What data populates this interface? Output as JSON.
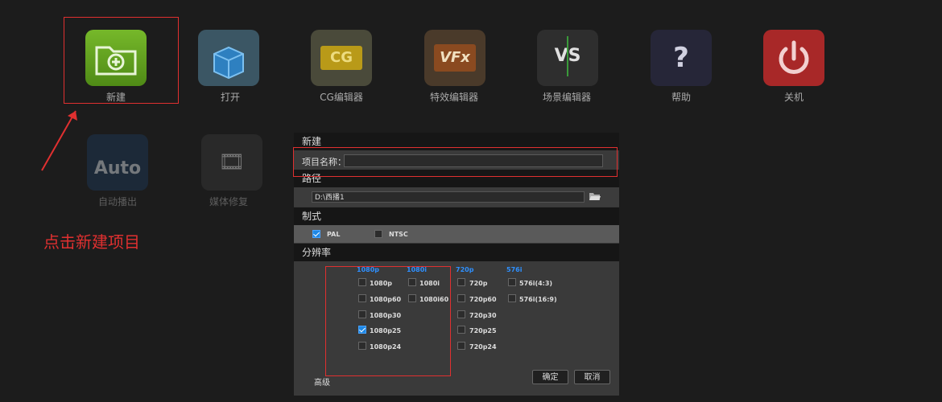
{
  "apps": [
    {
      "label": "新建",
      "glyph": "⊕"
    },
    {
      "label": "打开",
      "glyph": "📦"
    },
    {
      "label": "CG编辑器",
      "glyph": "CG"
    },
    {
      "label": "特效编辑器",
      "glyph": "VFx"
    },
    {
      "label": "场景编辑器",
      "glyph": "VS"
    },
    {
      "label": "帮助",
      "glyph": "?"
    },
    {
      "label": "关机",
      "glyph": "⏻"
    },
    {
      "label": "自动播出",
      "glyph": "Auto"
    },
    {
      "label": "媒体修复",
      "glyph": "🎞"
    }
  ],
  "annotation": {
    "text": "点击新建项目"
  },
  "dialog": {
    "title": "新建",
    "project_name_label": "项目名称：",
    "project_name_value": "",
    "path_label": "路径",
    "path_value": "D:\\西播1",
    "format_label": "制式",
    "formats": [
      {
        "label": "PAL",
        "checked": true
      },
      {
        "label": "NTSC",
        "checked": false
      }
    ],
    "resolution_label": "分辨率",
    "columns": [
      {
        "head": "1080p",
        "items": [
          {
            "label": "1080p",
            "checked": false
          },
          {
            "label": "1080p60",
            "checked": false
          },
          {
            "label": "1080p30",
            "checked": false
          },
          {
            "label": "1080p25",
            "checked": true
          },
          {
            "label": "1080p24",
            "checked": false
          }
        ]
      },
      {
        "head": "1080i",
        "items": [
          {
            "label": "1080i",
            "checked": false
          },
          {
            "label": "1080i60",
            "checked": false
          }
        ]
      },
      {
        "head": "720p",
        "items": [
          {
            "label": "720p",
            "checked": false
          },
          {
            "label": "720p60",
            "checked": false
          },
          {
            "label": "720p30",
            "checked": false
          },
          {
            "label": "720p25",
            "checked": false
          },
          {
            "label": "720p24",
            "checked": false
          }
        ]
      },
      {
        "head": "576i",
        "items": [
          {
            "label": "576i(4:3)",
            "checked": false
          },
          {
            "label": "576i(16:9)",
            "checked": false
          }
        ]
      }
    ],
    "advanced_label": "高级",
    "ok_label": "确定",
    "cancel_label": "取消"
  },
  "colors": {
    "accent": "#2e90ff",
    "annotation": "#e03030",
    "new_icon": "#5a9a1e"
  }
}
